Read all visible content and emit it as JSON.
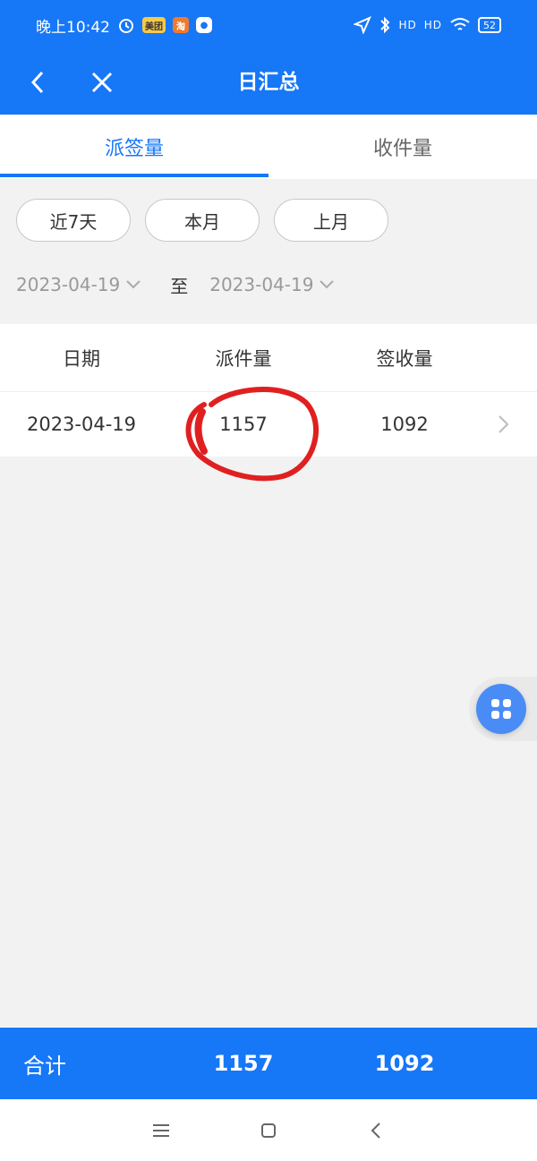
{
  "status_bar": {
    "time": "晚上10:42",
    "chip_a": "美团",
    "chip_b": "淘",
    "signal": "HD",
    "battery": "52"
  },
  "nav": {
    "title": "日汇总"
  },
  "tabs": [
    {
      "label": "派签量",
      "active": true
    },
    {
      "label": "收件量",
      "active": false
    }
  ],
  "filters": [
    "近7天",
    "本月",
    "上月"
  ],
  "date_range": {
    "start": "2023-04-19",
    "separator": "至",
    "end": "2023-04-19"
  },
  "table": {
    "headers": [
      "日期",
      "派件量",
      "签收量"
    ],
    "rows": [
      {
        "date": "2023-04-19",
        "dispatched": "1157",
        "signed": "1092"
      }
    ]
  },
  "summary": {
    "label": "合计",
    "dispatched_total": "1157",
    "signed_total": "1092"
  },
  "colors": {
    "primary": "#1677f7",
    "annotation": "#e02020",
    "fab": "#4a8cf6"
  },
  "icons": [
    "back-arrow-icon",
    "close-icon",
    "chevron-down-icon",
    "chevron-right-icon",
    "grid-menu-icon",
    "menu-icon",
    "home-icon",
    "back-icon"
  ]
}
